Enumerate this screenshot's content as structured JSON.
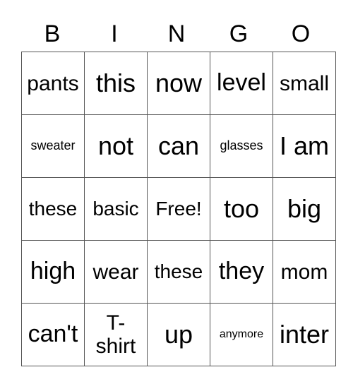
{
  "header": [
    "B",
    "I",
    "N",
    "G",
    "O"
  ],
  "rows": [
    [
      "pants",
      "this",
      "now",
      "level",
      "small"
    ],
    [
      "sweater",
      "not",
      "can",
      "glasses",
      "I am"
    ],
    [
      "these",
      "basic",
      "Free!",
      "too",
      "big"
    ],
    [
      "high",
      "wear",
      "these",
      "they",
      "mom"
    ],
    [
      "can't",
      "T-\nshirt",
      "up",
      "anymore",
      "inter"
    ]
  ]
}
